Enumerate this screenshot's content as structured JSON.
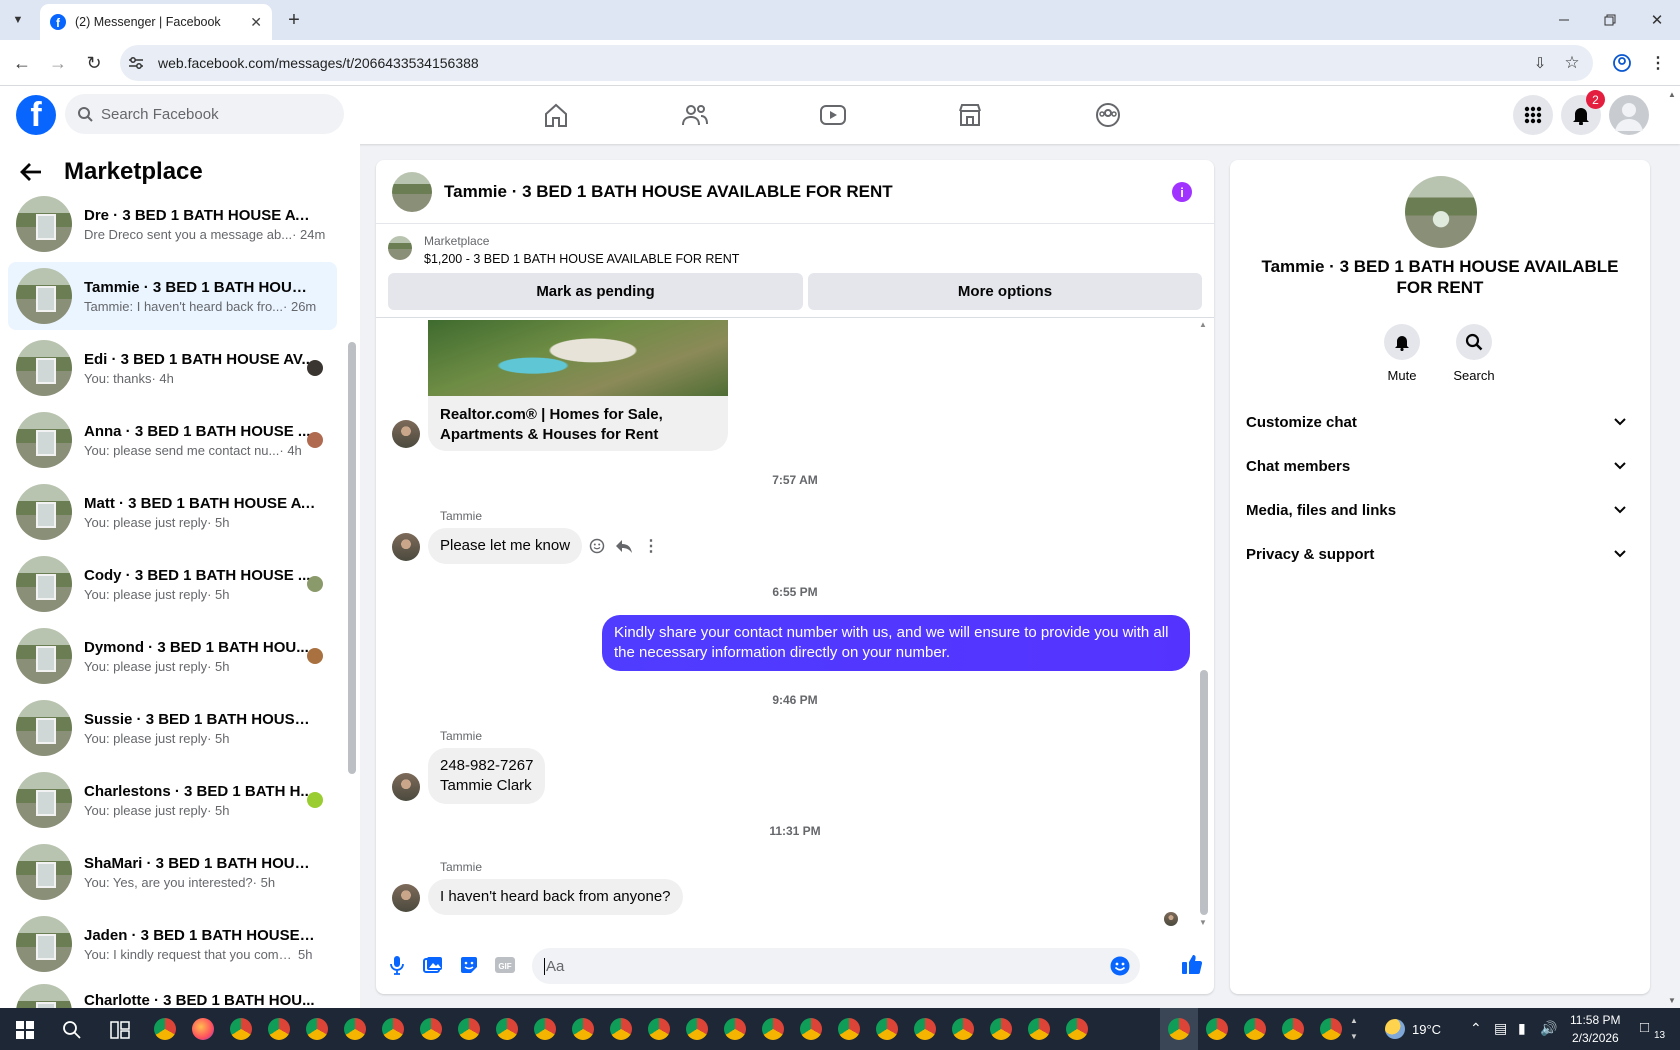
{
  "browser": {
    "tab_title": "(2) Messenger | Facebook",
    "url": "web.facebook.com/messages/t/2066433534156388"
  },
  "fb": {
    "search_placeholder": "Search Facebook",
    "notification_count": "2",
    "brand_color": "#0866ff"
  },
  "sidebar": {
    "title": "Marketplace",
    "conversations": [
      {
        "name": "Dre · 3 BED 1 BATH HOUSE AVAI...",
        "preview": "Dre Dreco sent you a message ab...",
        "time": "· 24m"
      },
      {
        "name": "Tammie · 3 BED 1 BATH HOUSE ...",
        "preview": "Tammie: I haven't heard back fro...",
        "time": "· 26m"
      },
      {
        "name": "Edi · 3 BED 1 BATH HOUSE AV...",
        "preview": "You: thanks",
        "time": "· 4h"
      },
      {
        "name": "Anna · 3 BED 1 BATH HOUSE ...",
        "preview": "You: please send me contact nu...",
        "time": "· 4h"
      },
      {
        "name": "Matt · 3 BED 1 BATH HOUSE AV...",
        "preview": "You: please just reply",
        "time": "· 5h"
      },
      {
        "name": "Cody · 3 BED 1 BATH HOUSE ...",
        "preview": "You: please just reply",
        "time": "· 5h"
      },
      {
        "name": "Dymond · 3 BED 1 BATH HOU...",
        "preview": "You: please just reply",
        "time": "· 5h"
      },
      {
        "name": "Sussie · 3 BED 1 BATH HOUSE AV...",
        "preview": "You: please just reply",
        "time": "· 5h"
      },
      {
        "name": "Charlestons · 3 BED 1 BATH H...",
        "preview": "You: please just reply",
        "time": "· 5h"
      },
      {
        "name": "ShaMari · 3 BED 1 BATH HOUSE ...",
        "preview": "You: Yes, are you interested?",
        "time": "· 5h"
      },
      {
        "name": "Jaden · 3 BED 1 BATH HOUSE AV...",
        "preview": "You: I kindly request that you comp...",
        "time": "5h"
      },
      {
        "name": "Charlotte · 3 BED 1 BATH HOU...",
        "preview": "",
        "time": ""
      }
    ]
  },
  "chat": {
    "title": "Tammie · 3 BED 1 BATH HOUSE AVAILABLE FOR RENT",
    "marketplace_label": "Marketplace",
    "listing": "$1,200 - 3 BED 1 BATH HOUSE AVAILABLE FOR RENT",
    "mark_pending": "Mark as pending",
    "more_options": "More options",
    "link_caption": "Realtor.com® | Homes for Sale, Apartments & Houses for Rent",
    "messages": [
      {
        "time": "7:57 AM",
        "sender": "Tammie",
        "text": "Please let me know"
      },
      {
        "time": "6:55 PM",
        "sender": "You",
        "text": "Kindly share your contact number with us, and we will ensure to provide you with all the necessary information directly on your number."
      },
      {
        "time": "9:46 PM",
        "sender": "Tammie",
        "line1": "248-982-7267",
        "line2": "Tammie Clark"
      },
      {
        "time": "11:31 PM",
        "sender": "Tammie",
        "text": "I haven't heard back from anyone?"
      }
    ],
    "composer_placeholder": "Aa",
    "outgoing_color": "#5533ff"
  },
  "info_panel": {
    "title": "Tammie · 3 BED 1 BATH HOUSE AVAILABLE FOR RENT",
    "mute": "Mute",
    "search": "Search",
    "sections": [
      "Customize chat",
      "Chat members",
      "Media, files and links",
      "Privacy & support"
    ]
  },
  "taskbar": {
    "weather": "19°C",
    "time": "11:58 PM",
    "date": "2/3/2026",
    "notifications": "13"
  }
}
